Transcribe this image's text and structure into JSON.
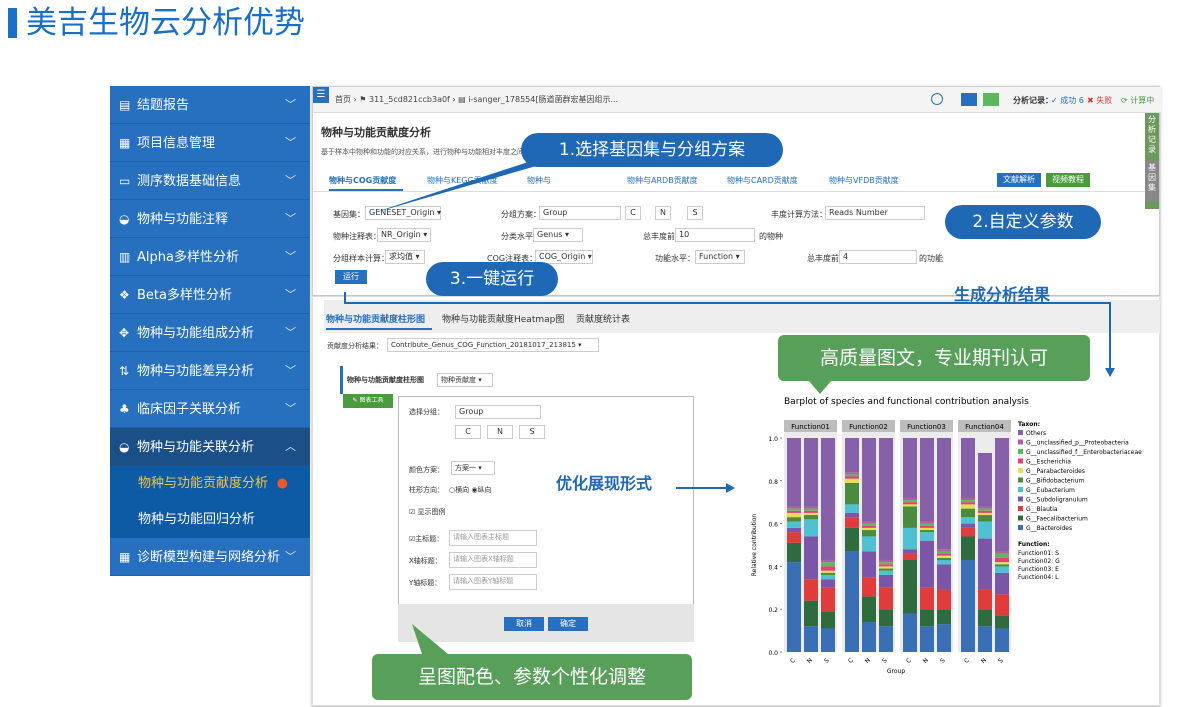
{
  "page_title": "美吉生物云分析优势",
  "sidebar": {
    "items": [
      {
        "icon": "▤",
        "label": "结题报告"
      },
      {
        "icon": "▦",
        "label": "项目信息管理"
      },
      {
        "icon": "▭",
        "label": "测序数据基础信息"
      },
      {
        "icon": "◒",
        "label": "物种与功能注释"
      },
      {
        "icon": "▥",
        "label": "Alpha多样性分析"
      },
      {
        "icon": "❖",
        "label": "Beta多样性分析"
      },
      {
        "icon": "✥",
        "label": "物种与功能组成分析"
      },
      {
        "icon": "⇅",
        "label": "物种与功能差异分析"
      },
      {
        "icon": "♣",
        "label": "临床因子关联分析"
      },
      {
        "icon": "◒",
        "label": "物种与功能关联分析"
      },
      {
        "label": "物种与功能贡献度分析"
      },
      {
        "label": "物种与功能回归分析"
      },
      {
        "icon": "▦",
        "label": "诊断模型构建与网络分析"
      }
    ]
  },
  "app": {
    "menu_icon": "☰",
    "breadcrumb": "首页 › ⚑ 311_5cd821ccb3a0f › ▤ i-sanger_178554[肠道菌群宏基因组示...",
    "record": "分析记录：",
    "success": "✓ 成功 6",
    "fail": "✖ 失败",
    "calc": "⟳ 计算中",
    "title": "物种与功能贡献度分析",
    "desc": "基于样本中物种和功能的对应关系，进行物种与功能相对丰度之间",
    "tabs": [
      "物种与COG贡献度",
      "物种与KEGG贡献度",
      "物种与",
      "物种与ARDB贡献度",
      "物种与CARD贡献度",
      "物种与VFDB贡献度"
    ],
    "doc_btn": "文献解析",
    "video_btn": "视频教程",
    "f": {
      "geneset_l": "基因集：",
      "geneset": "GENESET_Origin ▾",
      "group_l": "分组方案：",
      "group": "Group",
      "abund_l": "丰度计算方法：",
      "abund": "Reads Number",
      "anno_l": "物种注释表：",
      "anno": "NR_Origin ▾",
      "level_l": "分类水平：",
      "level": "Genus ▾",
      "total_l": "总丰度前",
      "total": "10",
      "total_s": "的物种",
      "sample_l": "分组样本计算：",
      "sample": "求均值 ▾",
      "cog_l": "COG注释表：",
      "cog": "COG_Origin ▾",
      "flevel_l": "功能水平：",
      "flevel": "Function ▾",
      "total2_l": "总丰度前",
      "total2": "4",
      "total2_s": "的功能",
      "run": "运行"
    },
    "side_tabs": [
      "分析记录",
      "基因集"
    ]
  },
  "result": {
    "tabs": [
      "物种与功能贡献度柱形图",
      "物种与功能贡献度Heatmap图",
      "贡献度统计表"
    ],
    "file_l": "贡献度分析结果：",
    "file": "Contribute_Genus_COG_Function_20181017_213815 ▾",
    "sub_title": "物种与功能贡献度柱形图",
    "sub_sel": "物种贡献度 ▾",
    "tool_btn": "✎ 图表工具",
    "dlg": {
      "group_l": "选择分组：",
      "group_ph": "Group",
      "scheme_l": "颜色方案：",
      "scheme": "方案一 ▾",
      "orient_l": "柱形方向：",
      "orient": "○横向 ◉纵向",
      "legend": "☑ 显示图例",
      "main_l": "☑主标题：",
      "main_ph": "请输入图表主标题",
      "x_l": "X轴标题：",
      "x_ph": "请输入图表X轴标题",
      "y_l": "Y轴标题：",
      "y_ph": "请输入图表Y轴标题",
      "cancel": "取消",
      "ok": "确定"
    }
  },
  "callouts": {
    "c1": "1.选择基因集与分组方案",
    "c2": "2.自定义参数",
    "c3": "3.一键运行",
    "gen": "生成分析结果",
    "quality": "高质量图文，专业期刊认可",
    "optimize": "优化展现形式",
    "color": "呈图配色、参数个性化调整"
  },
  "chart_data": {
    "type": "bar",
    "title": "Barplot of species and functional contribution analysis",
    "ylabel": "Relative contribution",
    "xlabel": "Group",
    "ylim": [
      0,
      1
    ],
    "yticks": [
      "0.0",
      "0.2",
      "0.4",
      "0.6",
      "0.8",
      "1.0"
    ],
    "facets": [
      "Function01",
      "Function02",
      "Function03",
      "Function04"
    ],
    "categories": [
      "C",
      "N",
      "S"
    ],
    "series": [
      {
        "name": "G__Bacteroides",
        "color": "#3a6fb5",
        "values": [
          [
            0.42,
            0.12,
            0.11
          ],
          [
            0.47,
            0.14,
            0.12
          ],
          [
            0.18,
            0.12,
            0.13
          ],
          [
            0.43,
            0.12,
            0.11
          ]
        ]
      },
      {
        "name": "G__Faecalibacterium",
        "color": "#2f6b3f",
        "values": [
          [
            0.09,
            0.12,
            0.08
          ],
          [
            0.11,
            0.12,
            0.08
          ],
          [
            0.25,
            0.08,
            0.07
          ],
          [
            0.11,
            0.08,
            0.06
          ]
        ]
      },
      {
        "name": "G__Blautia",
        "color": "#e03c3c",
        "values": [
          [
            0.05,
            0.1,
            0.11
          ],
          [
            0.05,
            0.09,
            0.1
          ],
          [
            0.03,
            0.1,
            0.09
          ],
          [
            0.04,
            0.09,
            0.1
          ]
        ]
      },
      {
        "name": "G__Subdoligranulum",
        "color": "#7b55a8",
        "values": [
          [
            0.02,
            0.2,
            0.04
          ],
          [
            0.02,
            0.12,
            0.06
          ],
          [
            0.02,
            0.22,
            0.12
          ],
          [
            0.02,
            0.24,
            0.1
          ]
        ]
      },
      {
        "name": "G__Eubacterium",
        "color": "#4fc1d0",
        "values": [
          [
            0.03,
            0.08,
            0.02
          ],
          [
            0.04,
            0.07,
            0.02
          ],
          [
            0.1,
            0.04,
            0.02
          ],
          [
            0.03,
            0.08,
            0.03
          ]
        ]
      },
      {
        "name": "G__Bifidobacterium",
        "color": "#4c8a3f",
        "values": [
          [
            0.02,
            0.02,
            0.01
          ],
          [
            0.1,
            0.03,
            0.01
          ],
          [
            0.1,
            0.01,
            0.01
          ],
          [
            0.04,
            0.03,
            0.01
          ]
        ]
      },
      {
        "name": "G__Parabacteroides",
        "color": "#e4df55",
        "values": [
          [
            0.02,
            0.01,
            0.01
          ],
          [
            0.02,
            0.01,
            0.01
          ],
          [
            0.01,
            0.01,
            0.01
          ],
          [
            0.02,
            0.01,
            0.01
          ]
        ]
      },
      {
        "name": "G__Escherichia",
        "color": "#e5407a",
        "values": [
          [
            0.01,
            0.01,
            0.02
          ],
          [
            0.01,
            0.01,
            0.01
          ],
          [
            0.01,
            0.01,
            0.01
          ],
          [
            0.01,
            0.01,
            0.02
          ]
        ]
      },
      {
        "name": "G__unclassified_f__Enterobacteriaceae",
        "color": "#5cb85c",
        "values": [
          [
            0.01,
            0.01,
            0.02
          ],
          [
            0.01,
            0.01,
            0.01
          ],
          [
            0.01,
            0.01,
            0.01
          ],
          [
            0.01,
            0.01,
            0.02
          ]
        ]
      },
      {
        "name": "G__unclassified_p__Proteobacteria",
        "color": "#b35fa6",
        "values": [
          [
            0.01,
            0.01,
            0.01
          ],
          [
            0.01,
            0.01,
            0.01
          ],
          [
            0.01,
            0.01,
            0.01
          ],
          [
            0.01,
            0.01,
            0.01
          ]
        ]
      },
      {
        "name": "Others",
        "color": "#8560a8",
        "values": [
          [
            0.32,
            0.32,
            0.57
          ],
          [
            0.16,
            0.39,
            0.57
          ],
          [
            0.28,
            0.39,
            0.52
          ],
          [
            0.28,
            0.25,
            0.53
          ]
        ]
      }
    ],
    "legend_title": "Taxon:",
    "legend_order": [
      "Others",
      "G__unclassified_p__Proteobacteria",
      "G__unclassified_f__Enterobacteriaceae",
      "G__Escherichia",
      "G__Parabacteroides",
      "G__Bifidobacterium",
      "G__Eubacterium",
      "G__Subdoligranulum",
      "G__Blautia",
      "G__Faecalibacterium",
      "G__Bacteroides"
    ],
    "function_title": "Function:",
    "function_map": [
      "Function01: S",
      "Function02: G",
      "Function03: E",
      "Function04: L"
    ]
  }
}
